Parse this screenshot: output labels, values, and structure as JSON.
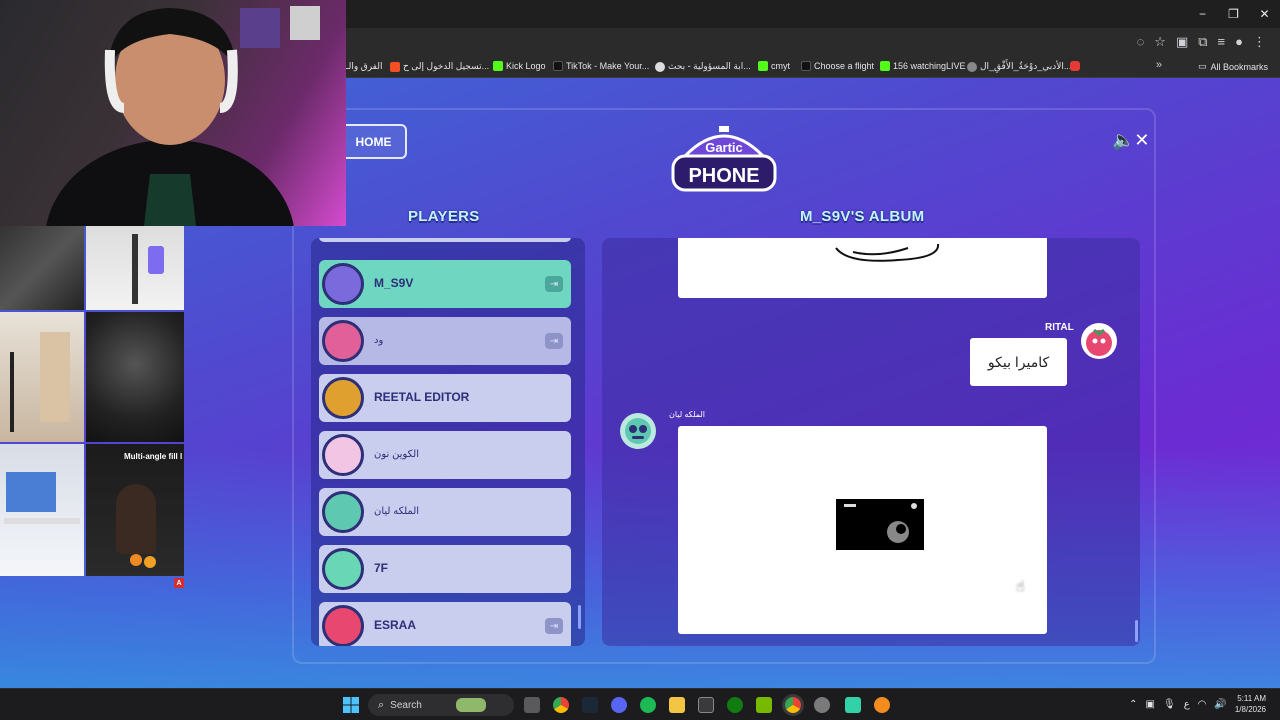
{
  "browser": {
    "window_controls": [
      "−",
      "❐",
      "✕"
    ],
    "bookmarks": [
      {
        "label": "الفرق والـ",
        "color": "#666"
      },
      {
        "label": "تسجيل الدخول إلى ح...",
        "color": "#f25022"
      },
      {
        "label": "Kick Logo",
        "color": "#53fc18"
      },
      {
        "label": "TikTok - Make Your...",
        "color": "#111"
      },
      {
        "label": "ابة المسؤولية - بحث...",
        "color": "#4285f4"
      },
      {
        "label": "cmyt",
        "color": "#53fc18"
      },
      {
        "label": "Choose a flight",
        "color": "#111"
      },
      {
        "label": "156 watchingLIVE",
        "color": "#53fc18"
      },
      {
        "label": "الأدبي_دوْحَةُ_الأَفْقِ_ال...",
        "color": "#888"
      }
    ],
    "more_bookmarks": "»",
    "all_bookmarks": "All Bookmarks"
  },
  "game": {
    "home_label": "HOME",
    "logo_top": "Gartic",
    "logo_bottom": "PHONE",
    "sound_icon": "🔈✕",
    "players_title": "PLAYERS",
    "album_title": "M_S9V'S ALBUM",
    "players": [
      {
        "name": "M_S9V",
        "state": "active",
        "kick": true,
        "avatar_color": "#7a6adb"
      },
      {
        "name": "ود",
        "state": "dim",
        "kick": true,
        "avatar_color": "#e2609a",
        "small": true
      },
      {
        "name": "REETAL EDITOR",
        "state": "normal",
        "kick": false,
        "avatar_color": "#e0a030"
      },
      {
        "name": "الكوين نون",
        "state": "normal",
        "kick": false,
        "avatar_color": "#f2c5e4",
        "small": true
      },
      {
        "name": "الملكه ليان",
        "state": "normal",
        "kick": false,
        "avatar_color": "#5fc8b0",
        "small": true
      },
      {
        "name": "7F",
        "state": "normal",
        "kick": false,
        "avatar_color": "#69d7b6"
      },
      {
        "name": "ESRAA",
        "state": "normal",
        "kick": true,
        "avatar_color": "#e84870"
      }
    ],
    "album": {
      "guess_author": "RITAL",
      "guess_text": "كاميرا بيكو",
      "drawing_author": "الملكه ليان"
    }
  },
  "taskbar": {
    "search_placeholder": "Search",
    "tray_lang": "ع",
    "time": "5:11 AM",
    "date": "1/8/2026"
  },
  "side_images": {
    "ad_text": "Multi-angle fill l",
    "ad_badge": "A"
  }
}
